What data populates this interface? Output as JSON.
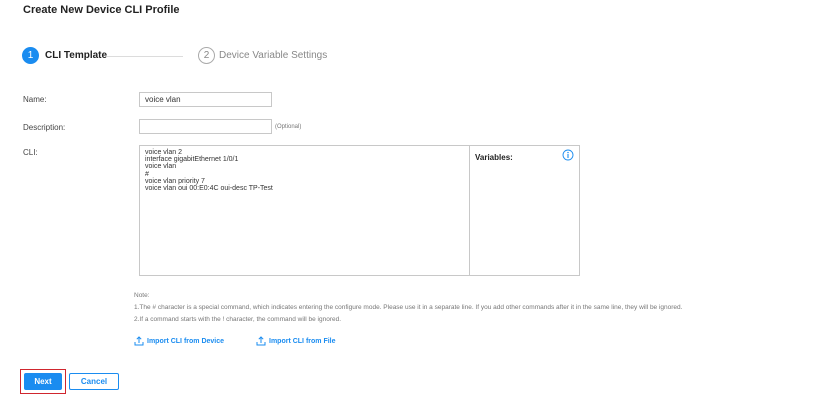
{
  "page": {
    "title": "Create New Device CLI Profile"
  },
  "steps": [
    {
      "number": "1",
      "label": "CLI Template"
    },
    {
      "number": "2",
      "label": "Device Variable Settings"
    }
  ],
  "form": {
    "name_label": "Name:",
    "name_value": "voice vlan",
    "description_label": "Description:",
    "description_value": "",
    "optional_hint": "(Optional)",
    "cli_label": "CLI:",
    "cli_text": "voice vlan 2\ninterface gigabitEthernet 1/0/1\nvoice vlan\n#\nvoice vlan priority 7\nvoice vlan oui 00:E0:4C oui-desc TP-Test",
    "variables_label": "Variables:"
  },
  "note": {
    "title": "Note:",
    "line1": "1.The # character is a special command, which indicates entering the configure mode. Please use it in a separate line. If you add other commands after it in the same line, they will be ignored.",
    "line2": "2.If a command starts with the ! character, the command will be ignored."
  },
  "links": {
    "import_device": "Import CLI from Device",
    "import_file": "Import CLI from File"
  },
  "buttons": {
    "next": "Next",
    "cancel": "Cancel"
  },
  "colors": {
    "accent": "#1a8cf0",
    "highlight": "#d0262e"
  }
}
